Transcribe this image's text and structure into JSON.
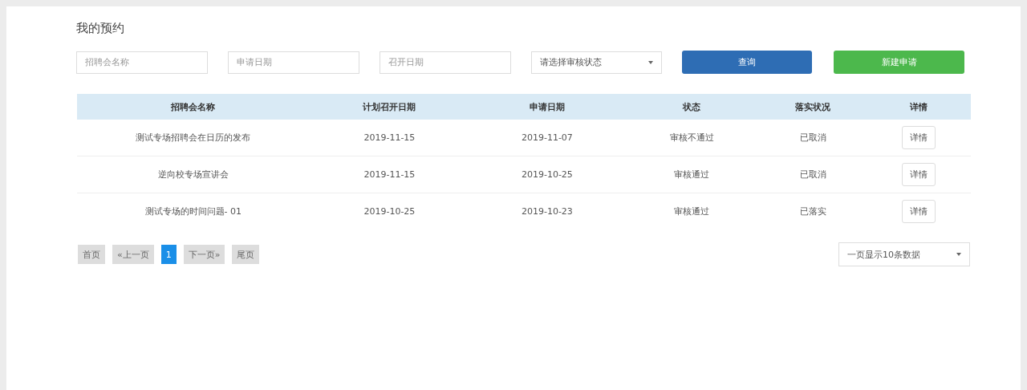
{
  "title": "我的预约",
  "filters": {
    "name": {
      "placeholder": "招聘会名称"
    },
    "apply_date": {
      "placeholder": "申请日期"
    },
    "open_date": {
      "placeholder": "召开日期"
    },
    "status": {
      "value": "请选择审核状态"
    },
    "search_button": "查询",
    "new_button": "新建申请"
  },
  "table": {
    "columns": [
      "招聘会名称",
      "计划召开日期",
      "申请日期",
      "状态",
      "落实状况",
      "详情"
    ],
    "rows": [
      {
        "cells": [
          "测试专场招聘会在日历的发布",
          "2019-11-15",
          "2019-11-07",
          "审核不通过",
          "已取消"
        ],
        "action": "详情"
      },
      {
        "cells": [
          "逆向校专场宣讲会",
          "2019-11-15",
          "2019-10-25",
          "审核通过",
          "已取消"
        ],
        "action": "详情"
      },
      {
        "cells": [
          "测试专场的时间问题- 01",
          "2019-10-25",
          "2019-10-23",
          "审核通过",
          "已落实"
        ],
        "action": "详情"
      }
    ]
  },
  "pagination": {
    "pages": [
      {
        "label": "首页",
        "selected": false
      },
      {
        "label": "«上一页",
        "selected": false
      },
      {
        "label": "1",
        "selected": true
      },
      {
        "label": "下一页»",
        "selected": false
      },
      {
        "label": "尾页",
        "selected": false
      }
    ],
    "page_size": "一页显示10条数据"
  }
}
